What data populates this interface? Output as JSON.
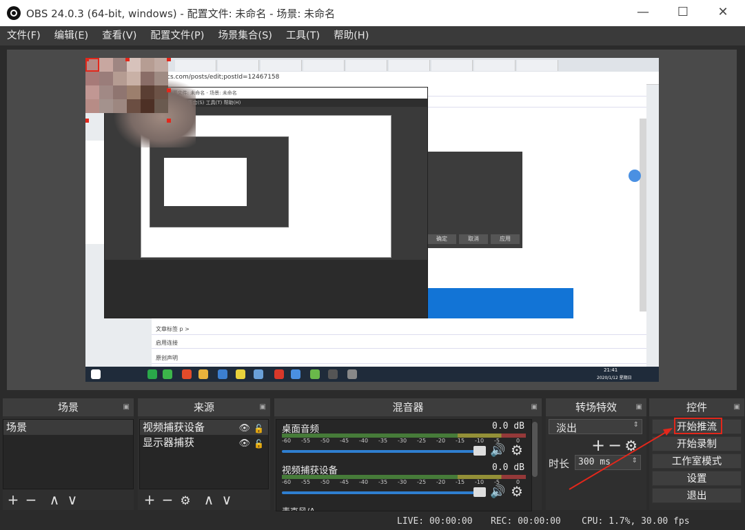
{
  "window": {
    "title": "OBS 24.0.3 (64-bit, windows) - 配置文件: 未命名 - 场景: 未命名",
    "minimize": "—",
    "maximize": "☐",
    "close": "✕"
  },
  "menu": [
    "文件(F)",
    "编辑(E)",
    "查看(V)",
    "配置文件(P)",
    "场景集合(S)",
    "工具(T)",
    "帮助(H)"
  ],
  "preview": {
    "address": "cs.com/posts/edit;postId=12467158",
    "nested_title": "OBS - 配置文件: 未命名 - 场景: 未命名",
    "nested_menu": "查看(V)    场景集合(S)    工具(T)    帮助(H)",
    "dialog_buttons": [
      "确定",
      "取消",
      "应用"
    ],
    "page_rows": [
      "文章标签 p >",
      "启用连接",
      "原创声明"
    ],
    "taskbar_time": "21:41",
    "taskbar_date": "2020/1/12 星期日"
  },
  "scenes": {
    "header": "场景",
    "items": [
      "场景"
    ]
  },
  "sources": {
    "header": "来源",
    "items": [
      "视频捕获设备",
      "显示器捕获"
    ]
  },
  "mixer": {
    "header": "混音器",
    "channels": [
      {
        "name": "桌面音频",
        "db": "0.0 dB",
        "volume": 1.0
      },
      {
        "name": "视频捕获设备",
        "db": "0.0 dB",
        "volume": 1.0
      }
    ],
    "scale": [
      "-60",
      "-55",
      "-50",
      "-45",
      "-40",
      "-35",
      "-30",
      "-25",
      "-20",
      "-15",
      "-10",
      "-5",
      "0"
    ],
    "partial_label": "麦克风/A"
  },
  "transitions": {
    "header": "转场特效",
    "selected": "淡出",
    "duration_label": "时长",
    "duration_value": "300 ms"
  },
  "controls": {
    "header": "控件",
    "buttons": [
      "开始推流",
      "开始录制",
      "工作室模式",
      "设置",
      "退出"
    ]
  },
  "status": {
    "live": "LIVE: 00:00:00",
    "rec": "REC: 00:00:00",
    "cpu": "CPU: 1.7%, 30.00 fps"
  },
  "colors": {
    "annotation": "#e3271b",
    "accent_blue": "#2f7fd0"
  }
}
